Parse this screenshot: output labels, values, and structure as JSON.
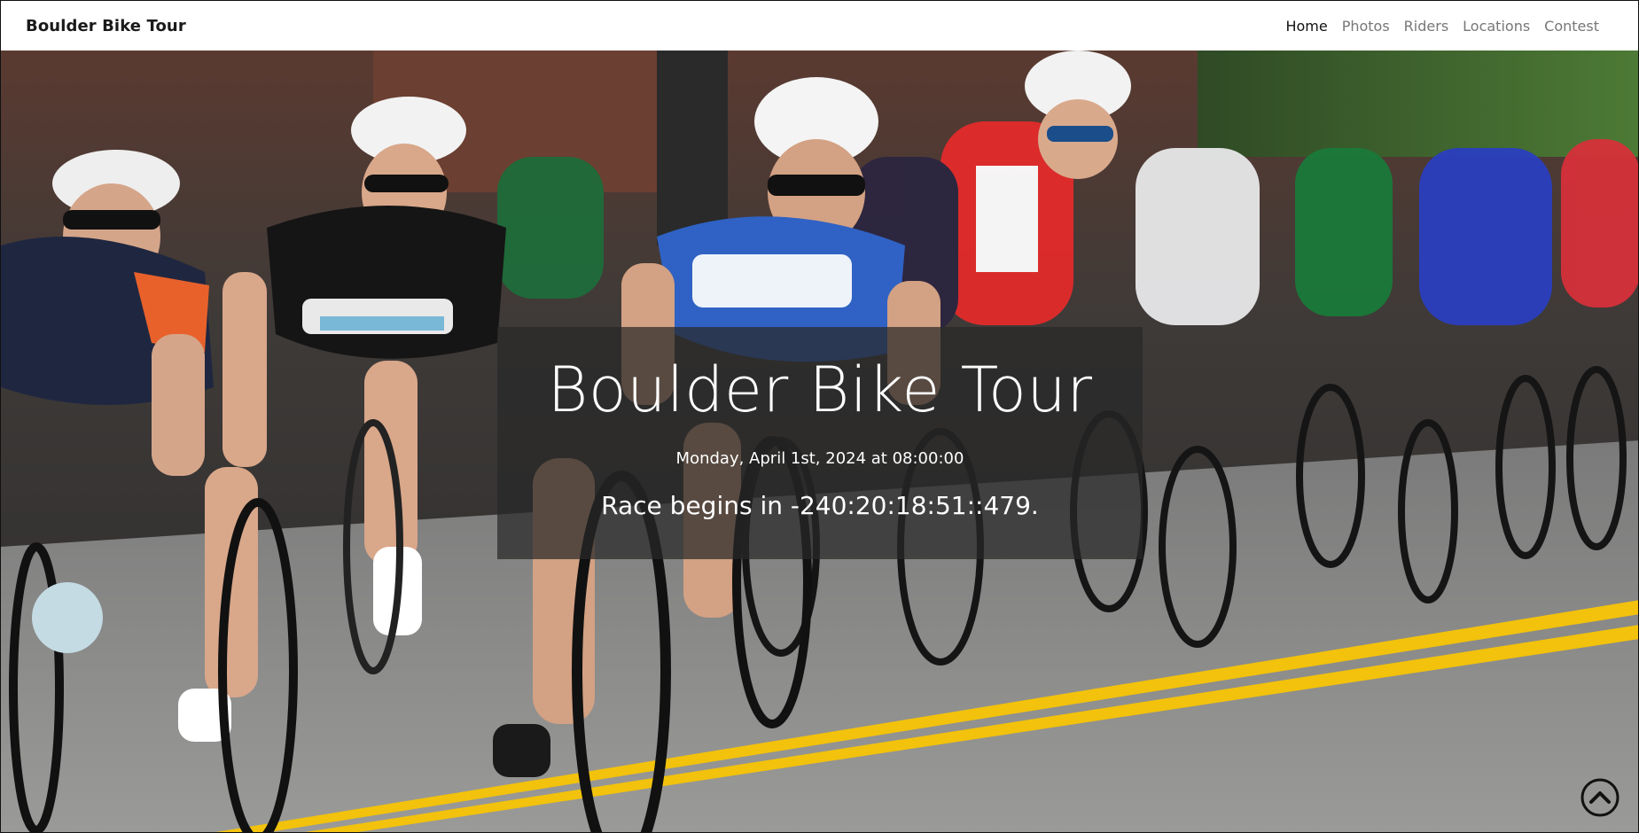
{
  "navbar": {
    "brand": "Boulder Bike Tour",
    "links": [
      {
        "label": "Home",
        "active": true
      },
      {
        "label": "Photos",
        "active": false
      },
      {
        "label": "Riders",
        "active": false
      },
      {
        "label": "Locations",
        "active": false
      },
      {
        "label": "Contest",
        "active": false
      }
    ]
  },
  "hero": {
    "title": "Boulder Bike Tour",
    "date": "Monday, April 1st, 2024 at 08:00:00",
    "countdown": "Race begins in -240:20:18:51::479."
  },
  "controls": {
    "back_to_top_icon": "chevron-up-circle-icon"
  },
  "colors": {
    "overlay": "#282828",
    "road": "#8a8a8a",
    "road_line": "#f2c20c",
    "nav_active": "#111111",
    "nav_inactive": "#777777"
  }
}
